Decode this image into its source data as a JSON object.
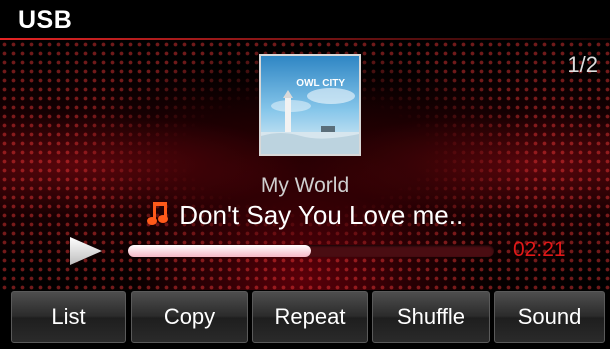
{
  "header": {
    "title": "USB"
  },
  "track_counter": "1/2",
  "now_playing": {
    "album_art_text": "OWL CITY",
    "artist": "My World",
    "title": "Don't Say You Love me..",
    "elapsed": "02:21",
    "progress": 0.5
  },
  "buttons": [
    {
      "label": "List"
    },
    {
      "label": "Copy"
    },
    {
      "label": "Repeat"
    },
    {
      "label": "Shuffle"
    },
    {
      "label": "Sound"
    }
  ],
  "colors": {
    "accent": "#e01818",
    "note": "#ff5a1a",
    "background": "#000000"
  }
}
